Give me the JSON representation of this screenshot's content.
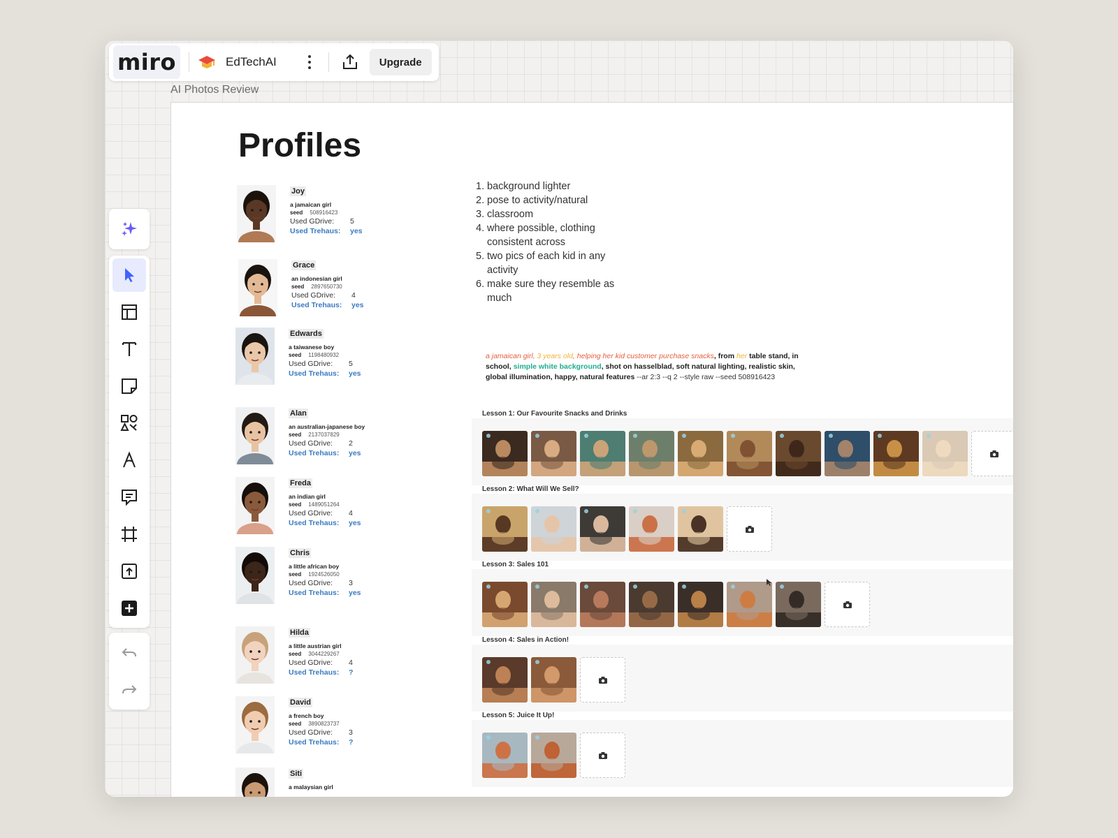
{
  "app": {
    "logo_text": "miro",
    "board_name": "EdTechAI",
    "upgrade_label": "Upgrade",
    "board_emoji": "graduation-cap"
  },
  "frame": {
    "title": "AI Photos Review"
  },
  "profiles": {
    "heading": "Profiles",
    "used_gdrive_label": "Used GDrive:",
    "used_trehaus_label": "Used Trehaus:",
    "seed_label": "seed",
    "items": [
      {
        "name": "Joy",
        "desc": "a jamaican girl",
        "seed": "508916423",
        "gdrive": "5",
        "trehaus": "yes",
        "skin": "#5a3826",
        "hair": "#1c120c",
        "bg": "#f4f4f4",
        "shirt": "#b07a55"
      },
      {
        "name": "Grace",
        "desc": "an indonesian girl",
        "seed": "2897650730",
        "gdrive": "4",
        "trehaus": "yes",
        "skin": "#e3b995",
        "hair": "#1a130e",
        "bg": "#f6f6f6",
        "shirt": "#8b5638"
      },
      {
        "name": "Edwards",
        "desc": "a taiwanese boy",
        "seed": "1198480932",
        "gdrive": "5",
        "trehaus": "yes",
        "skin": "#eac7a8",
        "hair": "#1a1410",
        "bg": "#dfe4ea",
        "shirt": "#e8ecef"
      },
      {
        "name": "Alan",
        "desc": "an australian-japanese boy",
        "seed": "2137037829",
        "gdrive": "2",
        "trehaus": "yes",
        "skin": "#e8c3a2",
        "hair": "#221a14",
        "bg": "#eef0f2",
        "shirt": "#7f8c97"
      },
      {
        "name": "Freda",
        "desc": "an indian girl",
        "seed": "1489051264",
        "gdrive": "4",
        "trehaus": "yes",
        "skin": "#8a5a3c",
        "hair": "#150e0a",
        "bg": "#f3f3f3",
        "shirt": "#d9a08a"
      },
      {
        "name": "Chris",
        "desc": "a little african boy",
        "seed": "1924526050",
        "gdrive": "3",
        "trehaus": "yes",
        "skin": "#3c2519",
        "hair": "#120b07",
        "bg": "#eceff1",
        "shirt": "#dfe3e6"
      },
      {
        "name": "Hilda",
        "desc": "a little austrian girl",
        "seed": "3044229267",
        "gdrive": "4",
        "trehaus": "?",
        "skin": "#f1d3bf",
        "hair": "#c8a27a",
        "bg": "#f2f2f2",
        "shirt": "#e7e3df"
      },
      {
        "name": "David",
        "desc": "a french boy",
        "seed": "3890823737",
        "gdrive": "3",
        "trehaus": "?",
        "skin": "#f0cdb1",
        "hair": "#9c6b3f",
        "bg": "#f4f4f4",
        "shirt": "#e6e8ea"
      },
      {
        "name": "Siti",
        "desc": "a malaysian girl",
        "seed": "",
        "gdrive": "",
        "trehaus": "",
        "skin": "#c99a73",
        "hair": "#1b120c",
        "bg": "#f2f2f2",
        "shirt": "#9a6a4c"
      }
    ]
  },
  "notes": [
    "background lighter",
    "pose to activity/natural",
    "classroom",
    "where possible, clothing consistent across",
    "two pics of each kid in any activity",
    "make sure they resemble as much"
  ],
  "prompt": {
    "p1": "a jamaican girl",
    "p2": "3 years old",
    "p3": "helping her kid customer purchase snacks",
    "p4": "from",
    "p5": "her",
    "p6": "table stand, in school,",
    "p7": "simple white background",
    "p8": ", shot on hasselblad, soft natural lighting, realistic skin, global illumination, happy, natural features",
    "p9": "--ar 2:3 --q 2 --style raw --seed 508916423"
  },
  "lessons": [
    {
      "title": "Lesson 1: Our Favourite Snacks and Drinks",
      "photos": [
        [
          "#3a2a20",
          "#c99467"
        ],
        [
          "#7a5a44",
          "#e2b48a"
        ],
        [
          "#4e7d72",
          "#d9a77a"
        ],
        [
          "#6d7f6a",
          "#c69a6e"
        ],
        [
          "#8a6a3e",
          "#e0b27a"
        ],
        [
          "#b28a5a",
          "#7a4b2e"
        ],
        [
          "#6a4a2e",
          "#3a2418"
        ],
        [
          "#2e4e6a",
          "#b08a6a"
        ],
        [
          "#5e3a22",
          "#d49a4a"
        ],
        [
          "#d9c9b5",
          "#f0dcc0"
        ]
      ]
    },
    {
      "title": "Lesson 2: What Will We Sell?",
      "photos": [
        [
          "#c9a46a",
          "#4a2c1c"
        ],
        [
          "#cfd4d8",
          "#e7c3a5"
        ],
        [
          "#3e3a36",
          "#eac7a8"
        ],
        [
          "#d9cfc6",
          "#c9663a"
        ],
        [
          "#e0c4a0",
          "#3a2418"
        ]
      ]
    },
    {
      "title": "Lesson 3: Sales 101",
      "photos": [
        [
          "#7a4a2e",
          "#e0b07a"
        ],
        [
          "#8a7a6a",
          "#e6c2a2"
        ],
        [
          "#6a4a3a",
          "#c08060"
        ],
        [
          "#4a3a30",
          "#a0704a"
        ],
        [
          "#3a2e28",
          "#c88a4a"
        ],
        [
          "#b09a8a",
          "#d07a3a"
        ],
        [
          "#7a6a5e",
          "#2e2520"
        ]
      ]
    },
    {
      "title": "Lesson 4: Sales in Action!",
      "photos": [
        [
          "#5a3a2a",
          "#c88a5a"
        ],
        [
          "#8a5a3a",
          "#d9a070"
        ]
      ]
    },
    {
      "title": "Lesson 5: Juice It Up!",
      "photos": [
        [
          "#a8b8c0",
          "#d06a3a"
        ],
        [
          "#b8a89a",
          "#c05a2a"
        ]
      ]
    }
  ]
}
